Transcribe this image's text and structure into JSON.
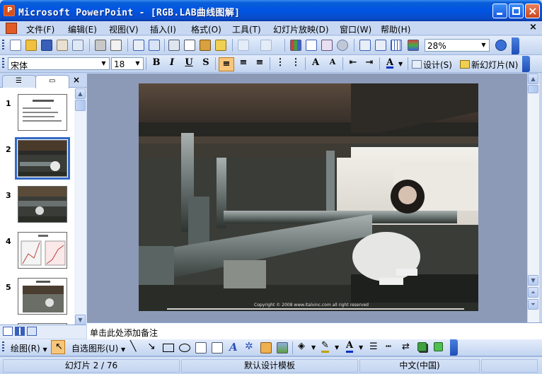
{
  "window": {
    "title": "Microsoft PowerPoint - [RGB.LAB曲线图解]"
  },
  "menu": {
    "items": [
      "文件(F)",
      "编辑(E)",
      "视图(V)",
      "插入(I)",
      "格式(O)",
      "工具(T)",
      "幻灯片放映(D)",
      "窗口(W)",
      "帮助(H)"
    ],
    "close_symbol": "×"
  },
  "standard_toolbar": {
    "zoom": "28%"
  },
  "format_toolbar": {
    "font_name": "宋体",
    "font_size": "18",
    "bold": "B",
    "italic": "I",
    "underline": "U",
    "shadow": "S",
    "design_label": "设计(S)",
    "new_slide_label": "新幻灯片(N)"
  },
  "slides_pane": {
    "close_symbol": "×",
    "slide_numbers": [
      "1",
      "2",
      "3",
      "4",
      "5"
    ],
    "selected_index": 2
  },
  "slide": {
    "copyright": "Copyright © 2008 www.italvinc.com all right reserved"
  },
  "notes": {
    "placeholder": "单击此处添加备注"
  },
  "drawing_toolbar": {
    "draw_label": "绘图(R)",
    "autoshapes_label": "自选图形(U)"
  },
  "status": {
    "slide_position": "幻灯片 2 / 76",
    "template": "默认设计模板",
    "language": "中文(中国)"
  },
  "colors": {
    "titlebar": "#0054e3",
    "toolbar": "#c2d4f0",
    "workspace": "#8c9ab8",
    "selection": "#316ac5"
  }
}
